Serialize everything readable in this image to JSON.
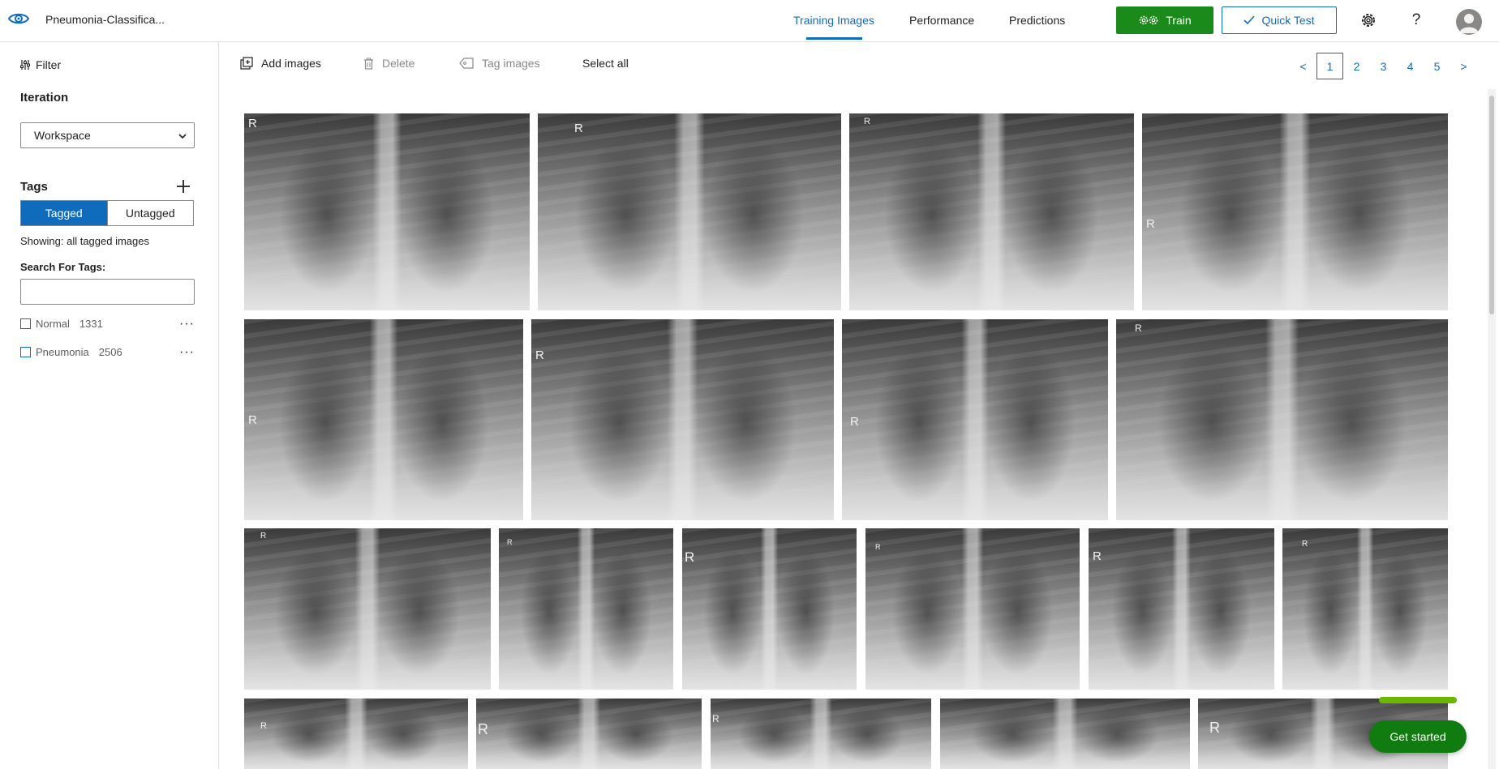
{
  "header": {
    "app_title": "Pneumonia-Classifica...",
    "tabs": [
      {
        "label": "Training Images",
        "active": true
      },
      {
        "label": "Performance",
        "active": false
      },
      {
        "label": "Predictions",
        "active": false
      }
    ],
    "train_label": "Train",
    "quick_test_label": "Quick Test",
    "help_glyph": "?"
  },
  "sidebar": {
    "filter_label": "Filter",
    "iteration_title": "Iteration",
    "iteration_value": "Workspace",
    "tags_title": "Tags",
    "toggle": {
      "tagged": "Tagged",
      "untagged": "Untagged",
      "selected": "Tagged"
    },
    "showing_text": "Showing: all tagged images",
    "search_label": "Search For Tags:",
    "search_value": "",
    "tags": [
      {
        "name": "Normal",
        "count": "1331"
      },
      {
        "name": "Pneumonia",
        "count": "2506"
      }
    ]
  },
  "toolbar": {
    "add_images": "Add images",
    "delete": "Delete",
    "tag_images": "Tag images",
    "select_all": "Select all"
  },
  "pagination": {
    "prev": "<",
    "pages": [
      "1",
      "2",
      "3",
      "4",
      "5"
    ],
    "current": "1",
    "next": ">"
  },
  "images": {
    "count_visible": 21,
    "marker_letter": "R"
  },
  "get_started": {
    "label": "Get started",
    "progress": 1.0
  },
  "colors": {
    "accent": "#0f6cbd",
    "train_green": "#1a8a1a",
    "get_started_green": "#107c10",
    "progress_green": "#6bb700"
  },
  "icons": {
    "logo": "eye-icon",
    "train": "gears-icon",
    "quick_test": "checkmark-icon",
    "settings": "gear-icon",
    "help": "question-icon",
    "filter": "filter-sliders-icon",
    "add_tag": "plus-icon",
    "add_images": "add-image-icon",
    "delete": "trash-icon",
    "tag_images": "tag-icon"
  }
}
